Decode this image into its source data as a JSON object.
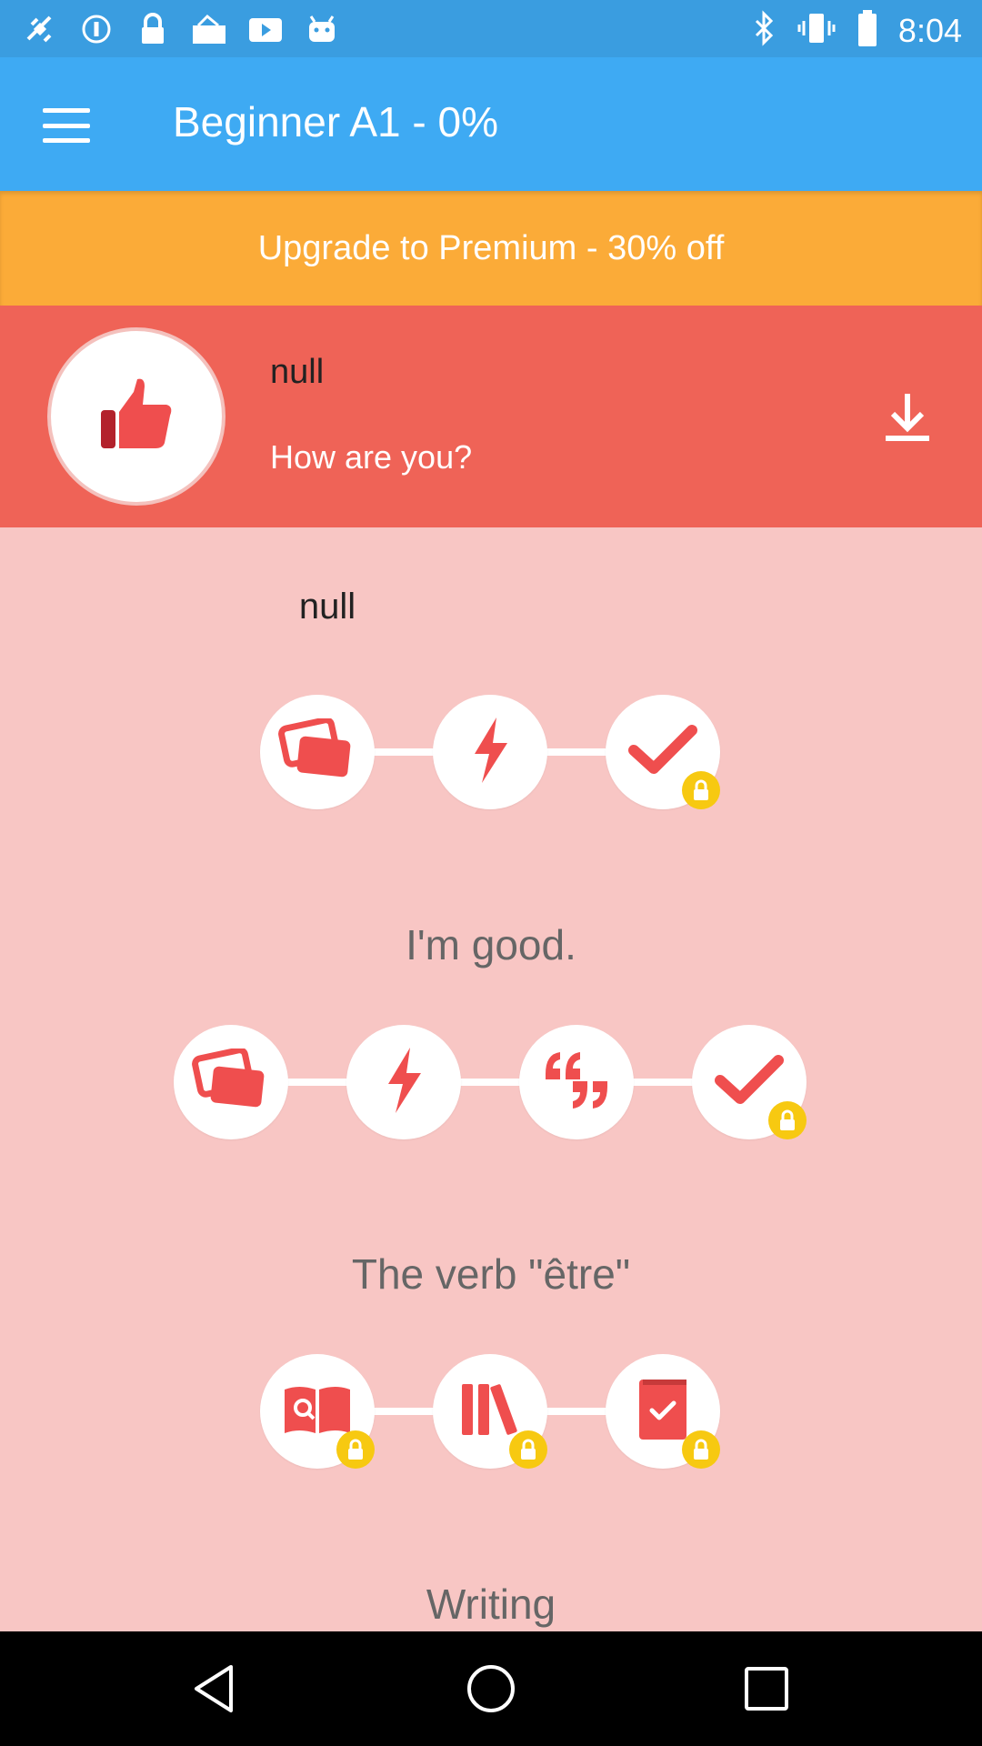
{
  "status_bar": {
    "time": "8:04",
    "left_icons": [
      "fake-gps-icon",
      "info-icon",
      "lock-icon",
      "mail-check-icon",
      "youtube-icon",
      "android-icon"
    ],
    "right_icons": [
      "bluetooth-icon",
      "vibrate-icon",
      "battery-icon"
    ]
  },
  "app_bar": {
    "title": "Beginner A1 - 0%",
    "menu_icon": "menu-icon"
  },
  "premium_banner": {
    "label": "Upgrade to Premium - 30% off"
  },
  "lesson": {
    "title": "null",
    "subtitle": "How are you?",
    "avatar_icon": "thumbs-up-icon",
    "download_icon": "download-icon"
  },
  "sections": [
    {
      "title": "null",
      "activities": [
        {
          "icon": "flashcards-icon",
          "locked": false
        },
        {
          "icon": "lightning-icon",
          "locked": false
        },
        {
          "icon": "check-icon",
          "locked": true
        }
      ]
    },
    {
      "title": "I'm good.",
      "activities": [
        {
          "icon": "flashcards-icon",
          "locked": false
        },
        {
          "icon": "lightning-icon",
          "locked": false
        },
        {
          "icon": "quote-icon",
          "locked": false
        },
        {
          "icon": "check-icon",
          "locked": true
        }
      ]
    },
    {
      "title": "The verb \"être\"",
      "activities": [
        {
          "icon": "book-search-icon",
          "locked": true
        },
        {
          "icon": "books-icon",
          "locked": true
        },
        {
          "icon": "book-check-icon",
          "locked": true
        }
      ]
    },
    {
      "title": "Writing"
    }
  ],
  "colors": {
    "status_bar": "#3a9de0",
    "app_bar": "#3eaaf3",
    "premium": "#fbab38",
    "lesson_header": "#ef6357",
    "background": "#f8c6c4",
    "icon_red": "#ef4e4e",
    "lock_yellow": "#f7c911"
  },
  "nav_bar": {
    "back": "back-icon",
    "home": "home-icon",
    "recents": "recents-icon"
  }
}
